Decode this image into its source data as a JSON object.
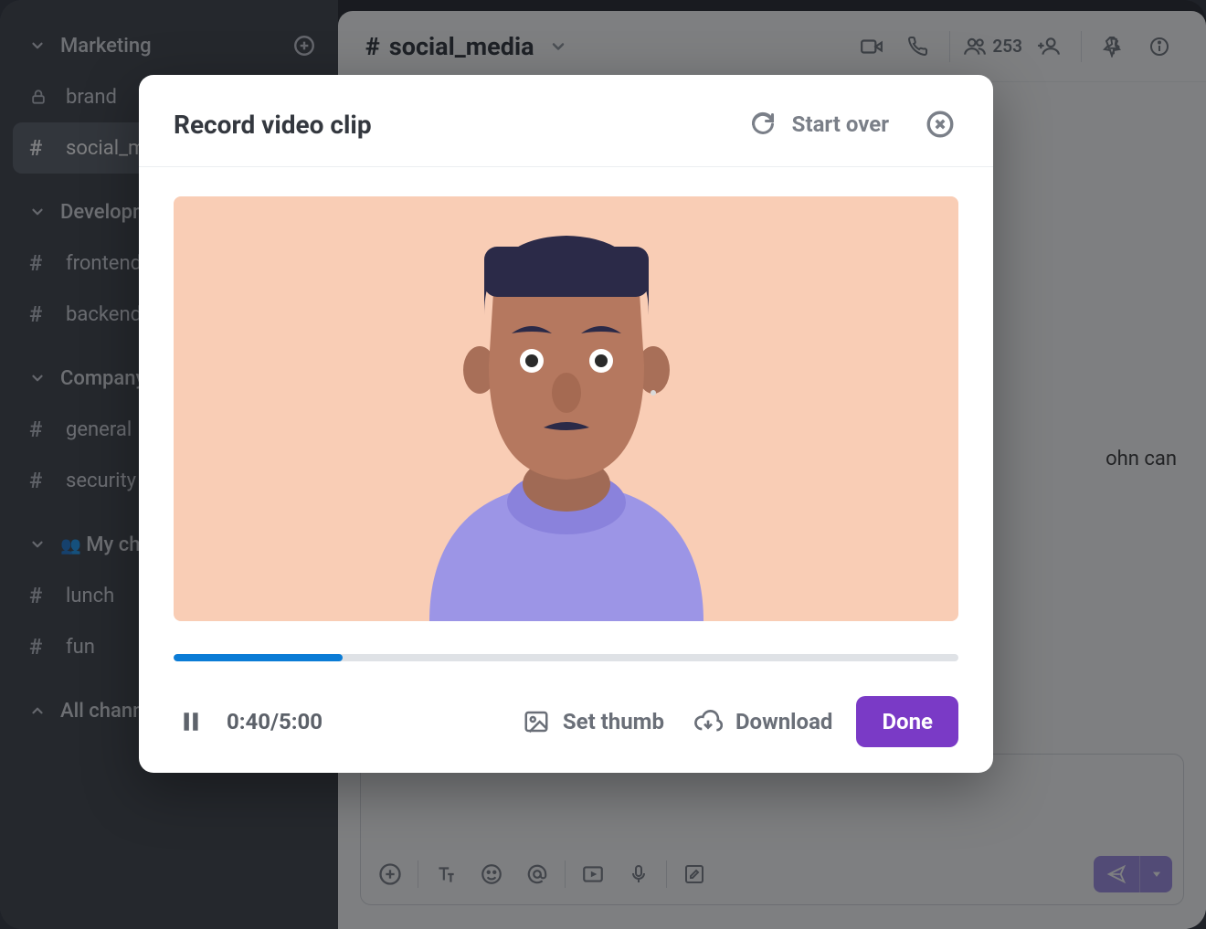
{
  "sidebar": {
    "sections": [
      {
        "label": "Marketing",
        "expanded": true,
        "has_add": true,
        "items": [
          {
            "type": "lock",
            "label": "brand"
          },
          {
            "type": "hash",
            "label": "social_media",
            "active": true
          }
        ]
      },
      {
        "label": "Development",
        "expanded": true,
        "items": [
          {
            "type": "hash",
            "label": "frontend"
          },
          {
            "type": "hash",
            "label": "backend"
          }
        ]
      },
      {
        "label": "Company",
        "expanded": true,
        "items": [
          {
            "type": "hash",
            "label": "general"
          },
          {
            "type": "hash",
            "label": "security"
          }
        ]
      },
      {
        "label": "My channels",
        "emoji": "👥",
        "expanded": true,
        "items": [
          {
            "type": "hash",
            "label": "lunch"
          },
          {
            "type": "hash",
            "label": "fun"
          }
        ]
      }
    ],
    "all_channels": {
      "label": "All channels",
      "expanded": false,
      "has_add": true
    }
  },
  "channel": {
    "name": "social_media",
    "member_count": "253",
    "visible_message_fragment": "ohn can"
  },
  "composer": {
    "icons": [
      "plus",
      "text-format",
      "emoji",
      "mention",
      "video",
      "mic",
      "edit"
    ]
  },
  "modal": {
    "title": "Record video clip",
    "start_over_label": "Start over",
    "time_display": "0:40/5:00",
    "set_thumb_label": "Set thumb",
    "download_label": "Download",
    "done_label": "Done",
    "progress_percent": 21.5
  },
  "colors": {
    "accent_purple": "#7a3ac6",
    "progress_blue": "#0b7cd6",
    "preview_bg": "#f9cdb5"
  }
}
